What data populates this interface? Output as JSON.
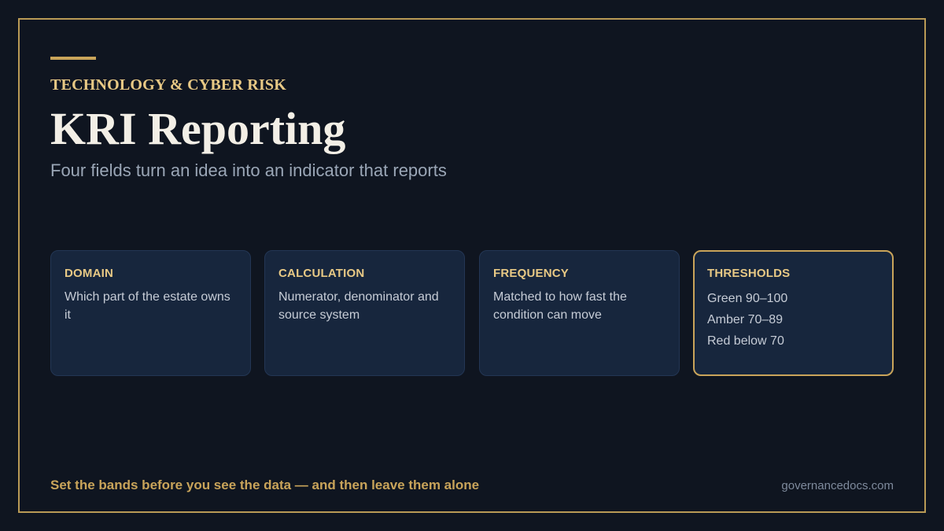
{
  "header": {
    "kicker": "TECHNOLOGY & CYBER RISK",
    "title": "KRI Reporting",
    "subtitle": "Four fields turn an idea into an indicator that reports"
  },
  "cards": [
    {
      "label": "DOMAIN",
      "text": "Which part of the estate owns it"
    },
    {
      "label": "CALCULATION",
      "text": "Numerator, denominator and source system"
    },
    {
      "label": "FREQUENCY",
      "text": "Matched to how fast the condition can move"
    },
    {
      "label": "THRESHOLDS",
      "lines": [
        "Green 90–100",
        "Amber 70–89",
        "Red below 70"
      ]
    }
  ],
  "footer": {
    "note": "Set the bands before you see the data — and then leave them alone",
    "site": "governancedocs.com"
  },
  "colors": {
    "background": "#0f1520",
    "accent": "#c9a45a",
    "card": "#17263d"
  }
}
